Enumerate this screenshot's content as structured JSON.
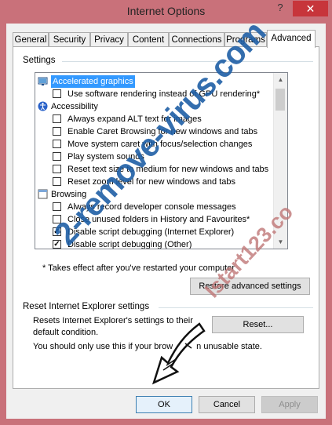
{
  "window": {
    "title": "Internet Options",
    "help_glyph": "?",
    "close_glyph": "✕"
  },
  "tabs": [
    {
      "label": "General"
    },
    {
      "label": "Security"
    },
    {
      "label": "Privacy"
    },
    {
      "label": "Content"
    },
    {
      "label": "Connections"
    },
    {
      "label": "Programs"
    },
    {
      "label": "Advanced",
      "active": true
    }
  ],
  "settings": {
    "group_label": "Settings",
    "items": [
      {
        "type": "category",
        "icon": "monitor-icon",
        "label": "Accelerated graphics",
        "selected": true
      },
      {
        "type": "checkbox",
        "checked": false,
        "label": "Use software rendering instead of GPU rendering*"
      },
      {
        "type": "category",
        "icon": "accessibility-icon",
        "label": "Accessibility"
      },
      {
        "type": "checkbox",
        "checked": false,
        "label": "Always expand ALT text for images"
      },
      {
        "type": "checkbox",
        "checked": false,
        "label": "Enable Caret Browsing for new windows and tabs"
      },
      {
        "type": "checkbox",
        "checked": false,
        "label": "Move system caret with focus/selection changes"
      },
      {
        "type": "checkbox",
        "checked": false,
        "label": "Play system sounds"
      },
      {
        "type": "checkbox",
        "checked": false,
        "label": "Reset text size to medium for new windows and tabs"
      },
      {
        "type": "checkbox",
        "checked": false,
        "label": "Reset zoom level for new windows and tabs"
      },
      {
        "type": "category",
        "icon": "browsing-icon",
        "label": "Browsing"
      },
      {
        "type": "checkbox",
        "checked": false,
        "label": "Always record developer console messages"
      },
      {
        "type": "checkbox",
        "checked": false,
        "label": "Close unused folders in History and Favourites*"
      },
      {
        "type": "checkbox",
        "checked": true,
        "label": "Disable script debugging (Internet Explorer)"
      },
      {
        "type": "checkbox",
        "checked": true,
        "label": "Disable script debugging (Other)"
      }
    ],
    "footnote": "* Takes effect after you've restarted your computer",
    "restore_button": "Restore advanced settings"
  },
  "reset": {
    "group_label": "Reset Internet Explorer settings",
    "description": "Resets Internet Explorer's settings to their default condition.",
    "button": "Reset...",
    "warning": "You should only use this if your brow",
    "warning_tail": "n unusable state."
  },
  "watermark": {
    "main": "2-remove-virus.com",
    "secondary": "Istart123.co"
  },
  "footer": {
    "ok": "OK",
    "cancel": "Cancel",
    "apply": "Apply"
  },
  "colors": {
    "frame": "#c9717a",
    "close": "#c7353b",
    "selection": "#3399ff",
    "watermark": "#1f5fa6"
  }
}
